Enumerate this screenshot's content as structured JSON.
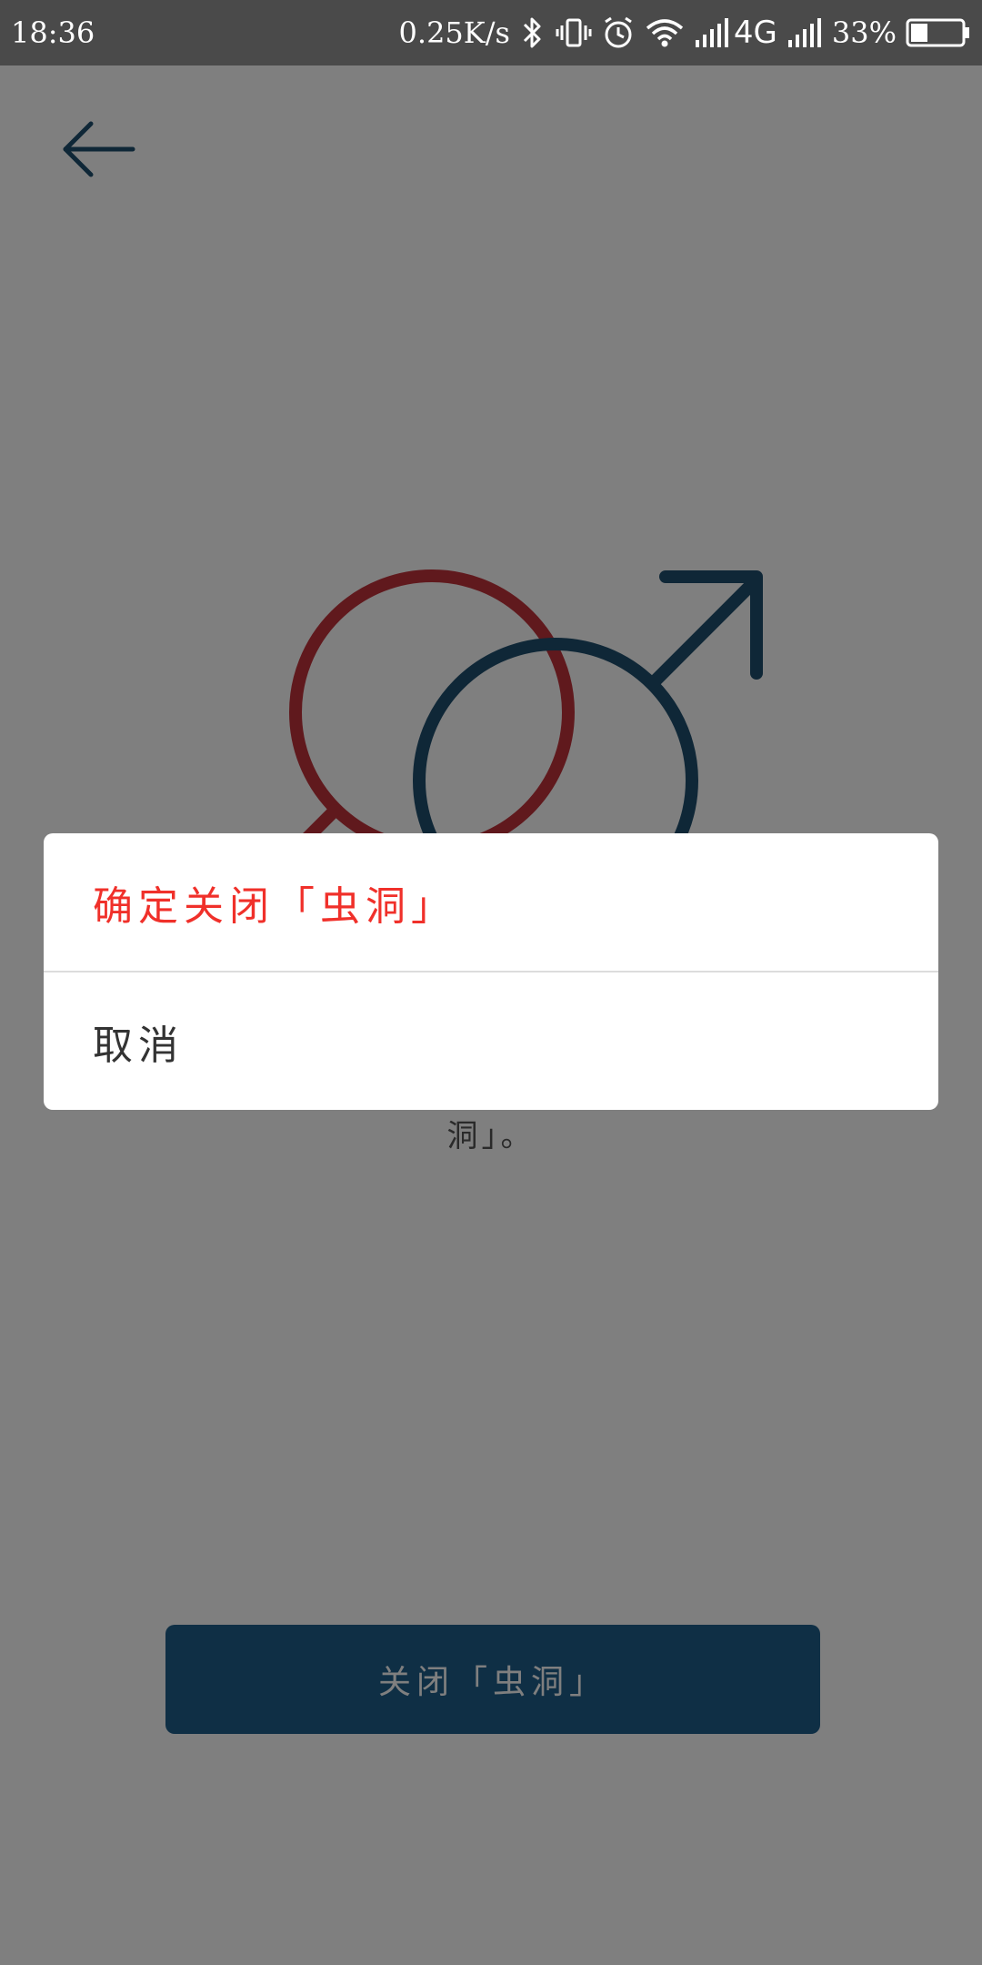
{
  "status_bar": {
    "time": "18:36",
    "net_speed": "0.25K/s",
    "network_type": "4G",
    "battery": "33%",
    "battery_level": 0.33,
    "icons": [
      "bluetooth-icon",
      "vibrate-icon",
      "alarm-icon",
      "wifi-icon",
      "signal-icon",
      "signal-icon-2",
      "battery-icon"
    ]
  },
  "page": {
    "description": "洞」。",
    "close_button_label": "关闭「虫洞」"
  },
  "dialog": {
    "confirm_label": "确定关闭「虫洞」",
    "cancel_label": "取消"
  },
  "colors": {
    "female_symbol": "#c0323a",
    "male_symbol": "#1f4f6e",
    "primary_button": "#1f5f8b",
    "confirm_text": "#f0302a",
    "overlay": "rgba(0,0,0,0.5)"
  }
}
